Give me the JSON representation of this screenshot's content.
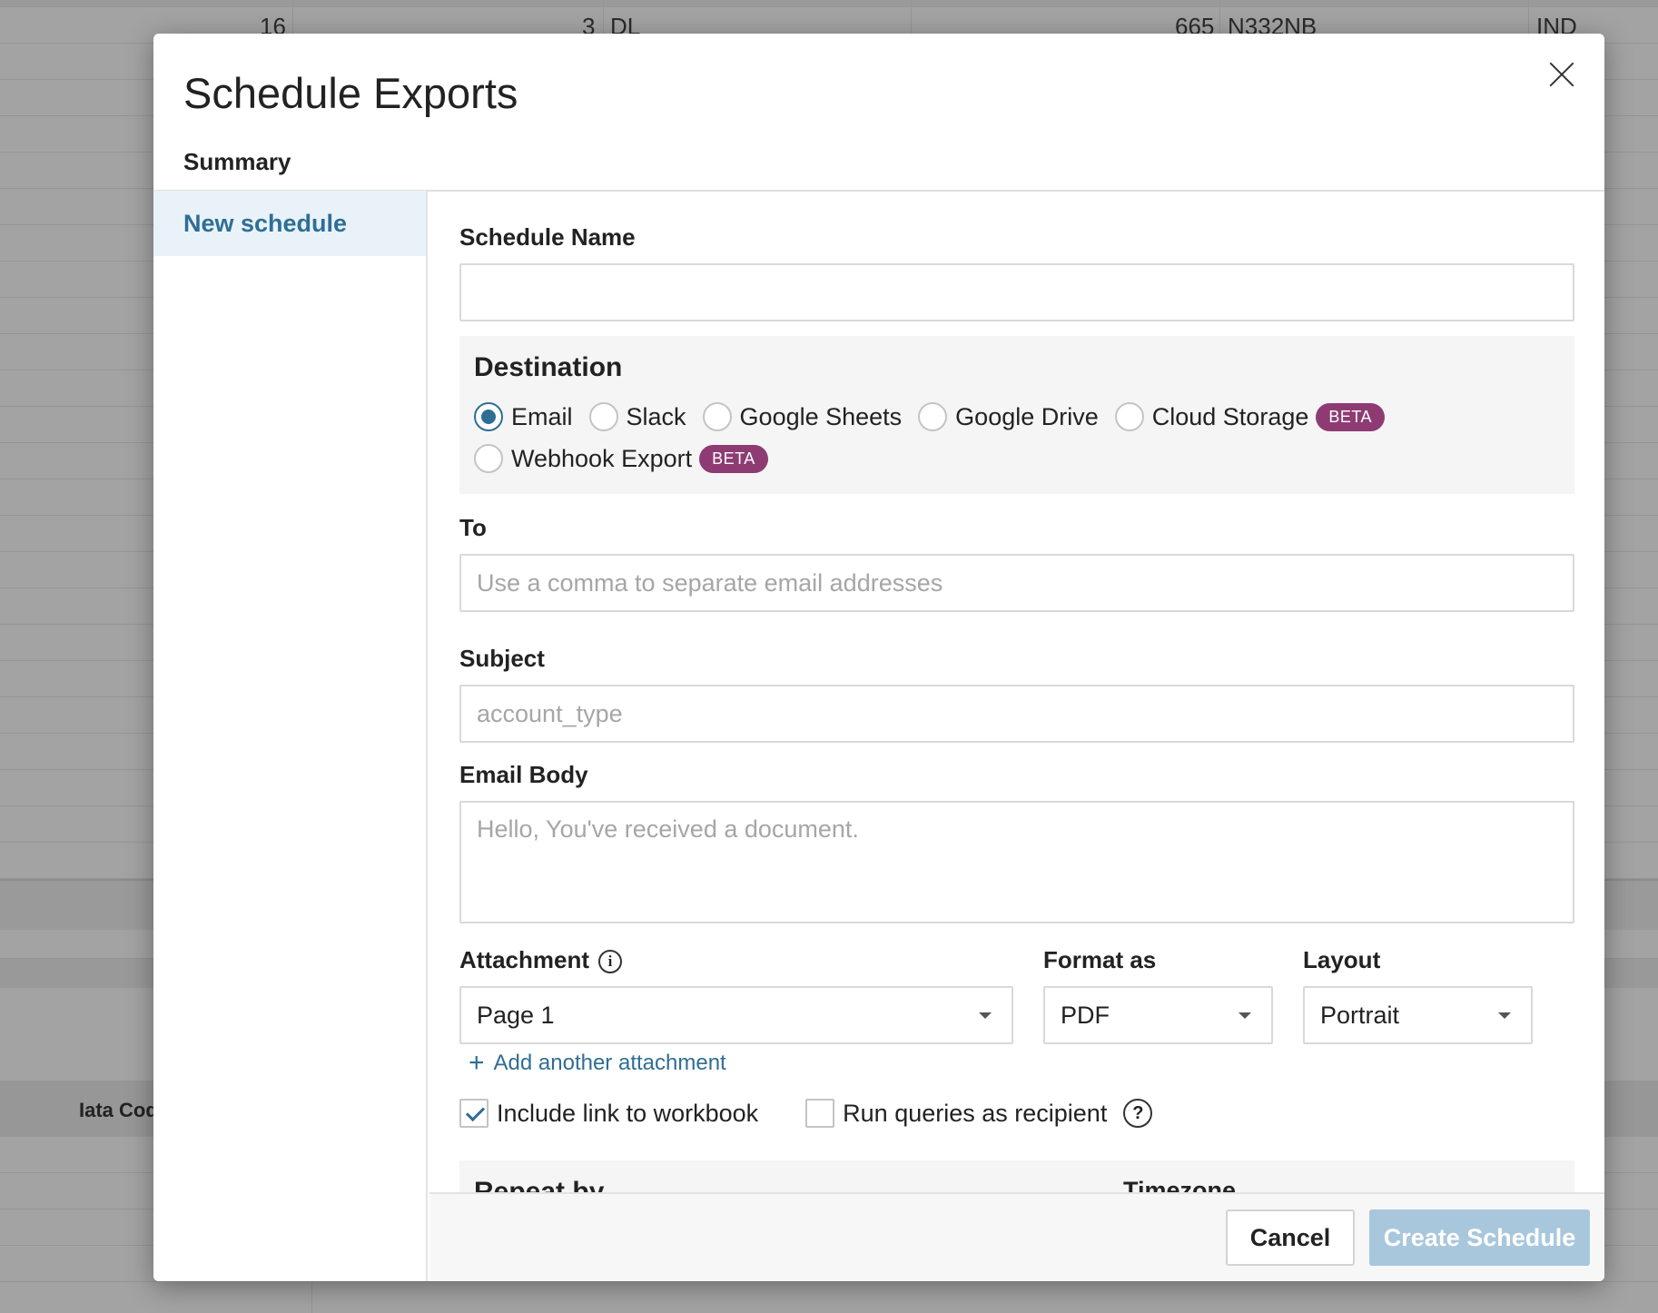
{
  "background": {
    "cells": [
      "16",
      "3",
      "DL",
      "665",
      "N332NB",
      "IND"
    ],
    "column_header": "Iata Cod"
  },
  "modal": {
    "title": "Schedule Exports",
    "summary_label": "Summary",
    "sidebar": {
      "items": [
        {
          "label": "New schedule"
        }
      ]
    }
  },
  "form": {
    "schedule_name": {
      "label": "Schedule Name",
      "value": "",
      "placeholder": ""
    },
    "destination": {
      "title": "Destination",
      "options": [
        {
          "label": "Email",
          "checked": true
        },
        {
          "label": "Slack",
          "checked": false
        },
        {
          "label": "Google Sheets",
          "checked": false
        },
        {
          "label": "Google Drive",
          "checked": false
        },
        {
          "label": "Cloud Storage",
          "checked": false,
          "badge": "BETA"
        },
        {
          "label": "Webhook Export",
          "checked": false,
          "badge": "BETA"
        }
      ]
    },
    "to": {
      "label": "To",
      "placeholder": "Use a comma to separate email addresses"
    },
    "subject": {
      "label": "Subject",
      "placeholder": "account_type"
    },
    "email_body": {
      "label": "Email Body",
      "placeholder": "Hello, You've received a document."
    },
    "attachment": {
      "label": "Attachment",
      "info_glyph": "i",
      "value": "Page 1"
    },
    "format": {
      "label": "Format as",
      "value": "PDF"
    },
    "layout": {
      "label": "Layout",
      "value": "Portrait"
    },
    "add_attachment": {
      "glyph": "+",
      "label": "Add another attachment"
    },
    "include_link": {
      "label": "Include link to workbook",
      "checked": true
    },
    "run_as_recipient": {
      "label": "Run queries as recipient",
      "checked": false,
      "help_glyph": "?"
    },
    "repeat_by": {
      "label": "Repeat by"
    },
    "timezone": {
      "label": "Timezone"
    }
  },
  "footer": {
    "cancel_label": "Cancel",
    "create_label": "Create Schedule"
  },
  "colors": {
    "accent": "#2f6e94",
    "beta_badge": "#8e3b73",
    "create_disabled": "#a9c7dc",
    "sidebar_selected_bg": "#e8f2f8"
  }
}
